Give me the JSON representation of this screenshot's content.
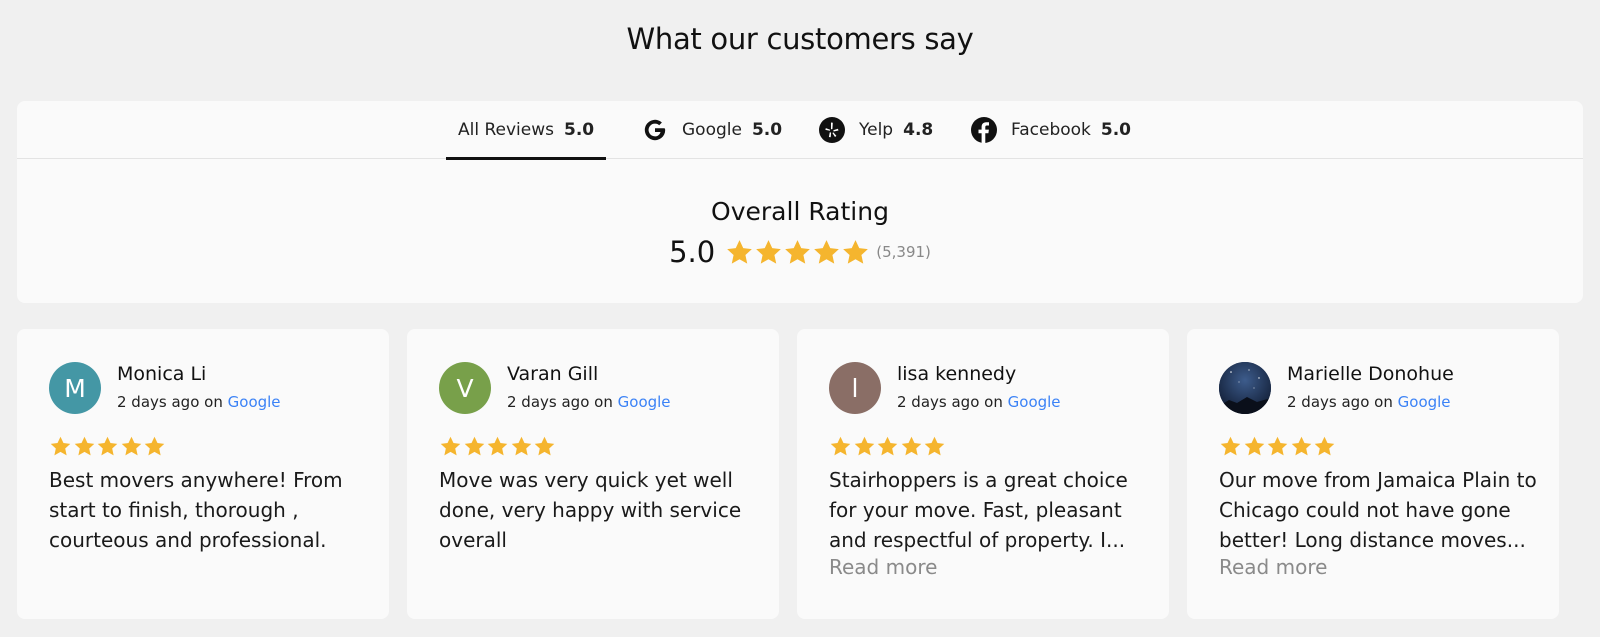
{
  "page": {
    "title": "What our customers say"
  },
  "tabs": [
    {
      "label": "All Reviews",
      "score": "5.0",
      "icon": "none"
    },
    {
      "label": "Google",
      "score": "5.0",
      "icon": "google-icon"
    },
    {
      "label": "Yelp",
      "score": "4.8",
      "icon": "yelp-icon"
    },
    {
      "label": "Facebook",
      "score": "5.0",
      "icon": "facebook-icon"
    }
  ],
  "overall": {
    "title": "Overall Rating",
    "score": "5.0",
    "count": "(5,391)",
    "stars": 5
  },
  "colors": {
    "star": "#f5b52e",
    "link": "#3b82f6"
  },
  "reviews": [
    {
      "name": "Monica Li",
      "initial": "M",
      "avatar_color": "#4497a5",
      "time": "2 days ago",
      "on": "on",
      "source": "Google",
      "rating": 5,
      "text": "Best movers anywhere! From start to finish, thorough , courteous and professional.",
      "read_more": ""
    },
    {
      "name": "Varan Gill",
      "initial": "V",
      "avatar_color": "#78a04a",
      "time": "2 days ago",
      "on": "on",
      "source": "Google",
      "rating": 5,
      "text": "Move was very quick yet well done, very happy with service overall",
      "read_more": ""
    },
    {
      "name": "lisa kennedy",
      "initial": "l",
      "avatar_color": "#8a6e66",
      "time": "2 days ago",
      "on": "on",
      "source": "Google",
      "rating": 5,
      "text": "Stairhoppers is a great choice for your move. Fast, pleasant and respectful of property. I...",
      "read_more": "Read more"
    },
    {
      "name": "Marielle Donohue",
      "initial": "",
      "avatar_color": "#1f2d4a",
      "time": "2 days ago",
      "on": "on",
      "source": "Google",
      "rating": 5,
      "text": "Our move from Jamaica Plain to Chicago could not have gone better! Long distance moves...",
      "read_more": "Read more"
    }
  ]
}
